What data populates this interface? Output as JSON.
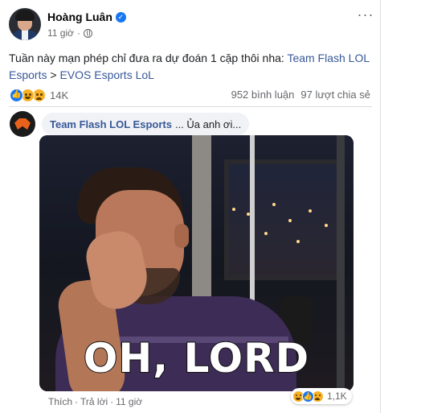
{
  "post": {
    "author": "Hoàng Luân",
    "time": "11 giờ",
    "text_prefix": "Tuần này mạn phép chỉ đưa ra dự đoán 1 cặp thôi nha: ",
    "link_team1": "Team Flash LOL Esports",
    "text_sep": " > ",
    "link_team2": "EVOS Esports LoL",
    "reaction_count": "14K",
    "comments_count": "952 bình luận",
    "shares_count": "97 lượt chia sẻ",
    "more_label": "···"
  },
  "comment": {
    "author": "Team Flash LOL Esports",
    "body": "... Ủa anh ơi...",
    "gif_caption": "OH, LORD",
    "like_label": "Thích",
    "reply_label": "Trả lời",
    "separator": "·",
    "time": "11 giờ",
    "reaction_count": "1,1K"
  },
  "colors": {
    "link": "#385898",
    "like_blue": "#1877f2",
    "haha_yellow": "#f7b125",
    "muted": "#65676b"
  },
  "icons": {
    "verified": "verified-badge-icon",
    "globe": "globe-icon",
    "more": "more-options-icon"
  }
}
